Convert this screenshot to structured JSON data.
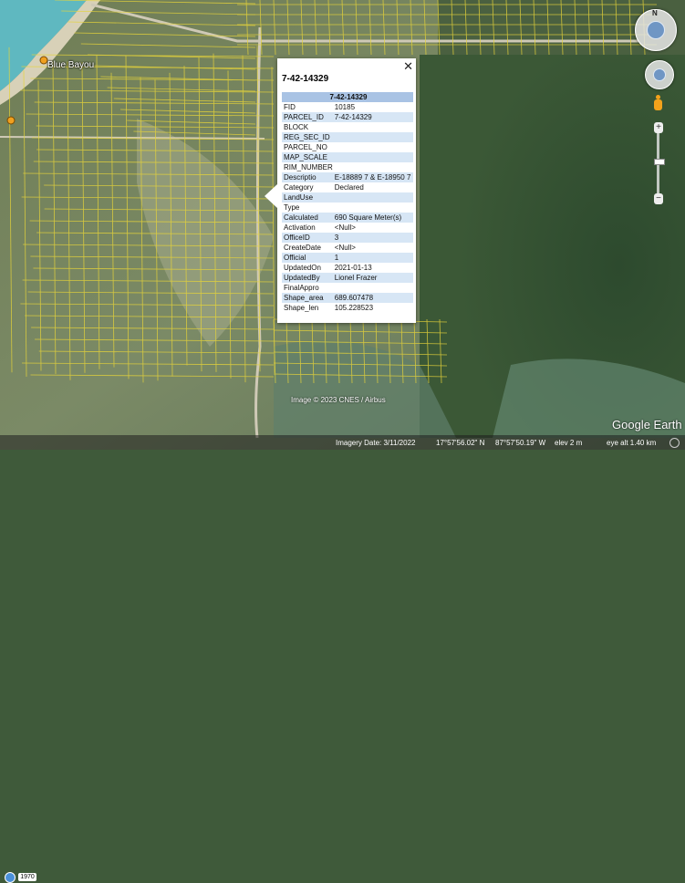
{
  "map": {
    "place_labels": [
      "Blue Bayou"
    ],
    "copyright": "Image © 2023 CNES / Airbus",
    "logo": "Google Earth",
    "colors": {
      "parcel_lines": "#e6d43a",
      "sea": "#5fb8c0"
    }
  },
  "popup": {
    "title": "7-42-14329",
    "close_label": "✕",
    "header": "7-42-14329",
    "rows": [
      {
        "key": "FID",
        "value": "10185"
      },
      {
        "key": "PARCEL_ID",
        "value": "7-42-14329"
      },
      {
        "key": "BLOCK",
        "value": ""
      },
      {
        "key": "REG_SEC_ID",
        "value": ""
      },
      {
        "key": "PARCEL_NO",
        "value": ""
      },
      {
        "key": "MAP_SCALE",
        "value": ""
      },
      {
        "key": "RIM_NUMBER",
        "value": ""
      },
      {
        "key": "Descriptio",
        "value": "E-18889 7 & E-18950 7"
      },
      {
        "key": "Category",
        "value": "Declared"
      },
      {
        "key": "LandUse",
        "value": ""
      },
      {
        "key": "Type",
        "value": ""
      },
      {
        "key": "Calculated",
        "value": "690 Square Meter(s)"
      },
      {
        "key": "Activation",
        "value": "<Null>"
      },
      {
        "key": "OfficeID",
        "value": "3"
      },
      {
        "key": "CreateDate",
        "value": "<Null>"
      },
      {
        "key": "Official",
        "value": "1"
      },
      {
        "key": "UpdatedOn",
        "value": "2021-01-13"
      },
      {
        "key": "UpdatedBy",
        "value": "Lionel Frazer"
      },
      {
        "key": "FinalAppro",
        "value": ""
      },
      {
        "key": "Shape_area",
        "value": "689.607478"
      },
      {
        "key": "Shape_len",
        "value": "105.228523"
      }
    ]
  },
  "navigation": {
    "compass_label": "N",
    "zoom_in": "+",
    "zoom_out": "−",
    "icons": [
      "look-joystick-icon",
      "move-joystick-icon",
      "street-view-pegman-icon",
      "zoom-slider-icon"
    ]
  },
  "status_bar": {
    "historical_year": "1970",
    "imagery_date": "Imagery Date: 3/11/2022",
    "lat": "17°57'56.02\" N",
    "lon": "87°57'50.19\" W",
    "elev": "elev      2 m",
    "eye_alt": "eye alt   1.40 km"
  }
}
